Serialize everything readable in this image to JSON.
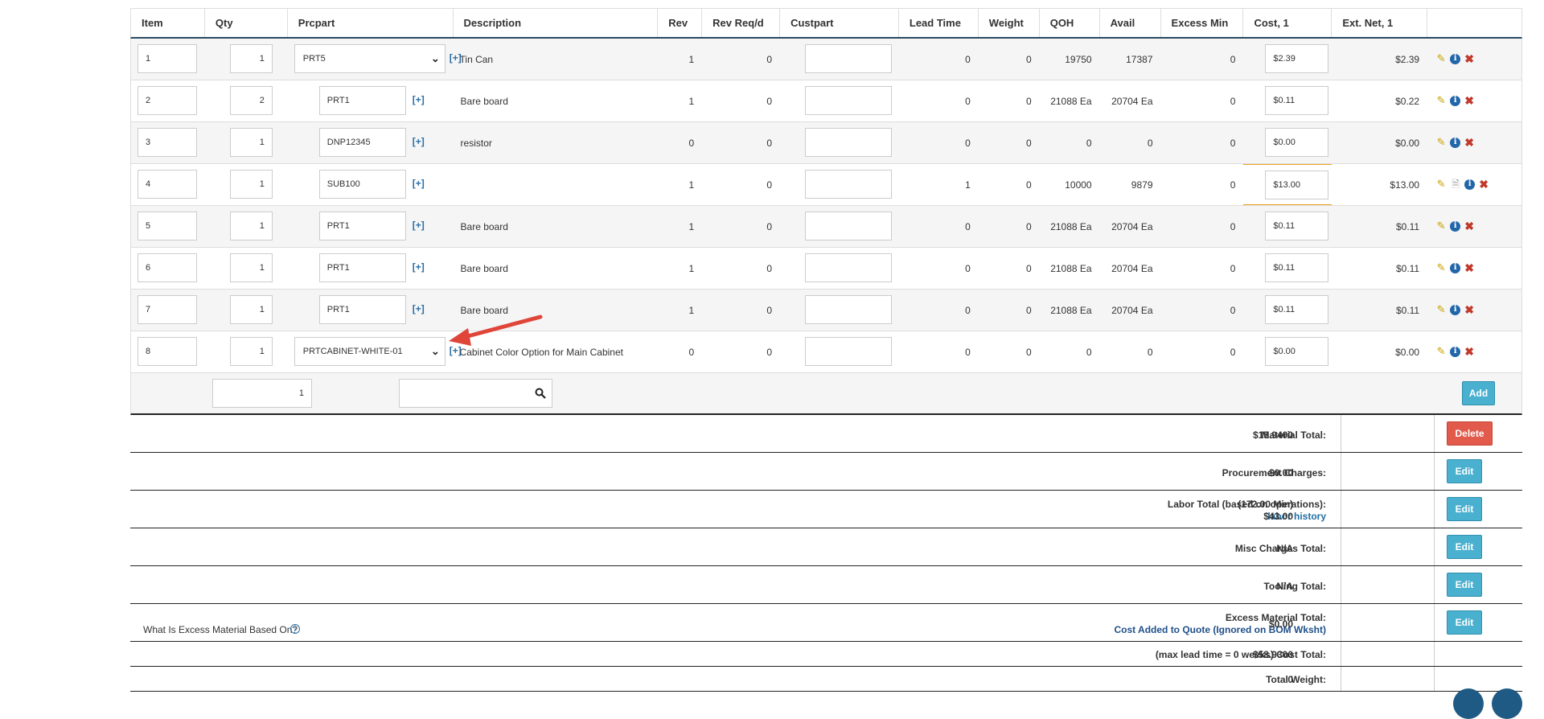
{
  "columns": [
    "Item",
    "Qty",
    "Prcpart",
    "Description",
    "Rev",
    "Rev Req/d",
    "Custpart",
    "Lead Time",
    "Weight",
    "QOH",
    "Avail",
    "Excess Min",
    "Cost, 1",
    "Ext. Net, 1"
  ],
  "rows": [
    {
      "item": "1",
      "qty": "1",
      "prcpart": "PRT5",
      "prc_select": true,
      "desc": "Tin Can",
      "rev": "1",
      "rev_req": "0",
      "custpart": "",
      "lead": "0",
      "weight": "0",
      "qoh": "19750",
      "avail": "17387",
      "excess": "0",
      "cost": "$2.39",
      "ext": "$2.39"
    },
    {
      "item": "2",
      "qty": "2",
      "prcpart": "PRT1",
      "prc_select": false,
      "desc": "Bare board",
      "rev": "1",
      "rev_req": "0",
      "custpart": "",
      "lead": "0",
      "weight": "0",
      "qoh": "21088 Ea",
      "avail": "20704 Ea",
      "excess": "0",
      "cost": "$0.11",
      "ext": "$0.22"
    },
    {
      "item": "3",
      "qty": "1",
      "prcpart": "DNP12345",
      "prc_select": false,
      "desc": "resistor",
      "rev": "0",
      "rev_req": "0",
      "custpart": "",
      "lead": "0",
      "weight": "0",
      "qoh": "0",
      "avail": "0",
      "excess": "0",
      "cost": "$0.00",
      "ext": "$0.00"
    },
    {
      "item": "4",
      "qty": "1",
      "prcpart": "SUB100",
      "prc_select": false,
      "desc": "",
      "rev": "1",
      "rev_req": "0",
      "custpart": "",
      "lead": "1",
      "weight": "0",
      "qoh": "10000",
      "avail": "9879",
      "excess": "0",
      "cost": "$13.00",
      "ext": "$13.00"
    },
    {
      "item": "5",
      "qty": "1",
      "prcpart": "PRT1",
      "prc_select": false,
      "desc": "Bare board",
      "rev": "1",
      "rev_req": "0",
      "custpart": "",
      "lead": "0",
      "weight": "0",
      "qoh": "21088 Ea",
      "avail": "20704 Ea",
      "excess": "0",
      "cost": "$0.11",
      "ext": "$0.11"
    },
    {
      "item": "6",
      "qty": "1",
      "prcpart": "PRT1",
      "prc_select": false,
      "desc": "Bare board",
      "rev": "1",
      "rev_req": "0",
      "custpart": "",
      "lead": "0",
      "weight": "0",
      "qoh": "21088 Ea",
      "avail": "20704 Ea",
      "excess": "0",
      "cost": "$0.11",
      "ext": "$0.11"
    },
    {
      "item": "7",
      "qty": "1",
      "prcpart": "PRT1",
      "prc_select": false,
      "desc": "Bare board",
      "rev": "1",
      "rev_req": "0",
      "custpart": "",
      "lead": "0",
      "weight": "0",
      "qoh": "21088 Ea",
      "avail": "20704 Ea",
      "excess": "0",
      "cost": "$0.11",
      "ext": "$0.11"
    },
    {
      "item": "8",
      "qty": "1",
      "prcpart": "PRTCABINET-WHITE-01",
      "prc_select": true,
      "desc": "Cabinet Color Option for Main Cabinet",
      "rev": "0",
      "rev_req": "0",
      "custpart": "",
      "lead": "0",
      "weight": "0",
      "qoh": "0",
      "avail": "0",
      "excess": "0",
      "cost": "$0.00",
      "ext": "$0.00"
    }
  ],
  "plus_label": "[+]",
  "add_row": {
    "qty": "1",
    "search": "",
    "add_label": "Add"
  },
  "totals": {
    "material_label": "Material Total:",
    "material_value": "$15.9400",
    "delete_label": "Delete",
    "procurement_label": "Procurement Charges:",
    "procurement_value": "$0.00",
    "labor_label": "Labor Total (based on operations):",
    "labor_link": "labor history",
    "labor_min": "(172.00 Min)",
    "labor_value": "$43.00",
    "misc_label": "Misc Charges Total:",
    "misc_value": "N/A",
    "tooling_label": "Tooling Total:",
    "tooling_value": "N/A",
    "excess_question": "What Is Excess Material Based On?",
    "excess_label": "Excess Material Total:",
    "excess_link": "Cost Added to Quote (Ignored on BOM Wksht)",
    "excess_value": "$0.00",
    "cost_total_label": "(max lead time = 0 weeks) Cost Total:",
    "cost_total_value": "$58.9300",
    "weight_label": "Total Weight:",
    "weight_value": "0",
    "edit_label": "Edit"
  },
  "colors": {
    "header_border": "#2a4a60",
    "button_blue": "#4ab0cf",
    "button_red": "#e15a4b",
    "arrow": "#e0453a",
    "link": "#1f6ea5"
  }
}
